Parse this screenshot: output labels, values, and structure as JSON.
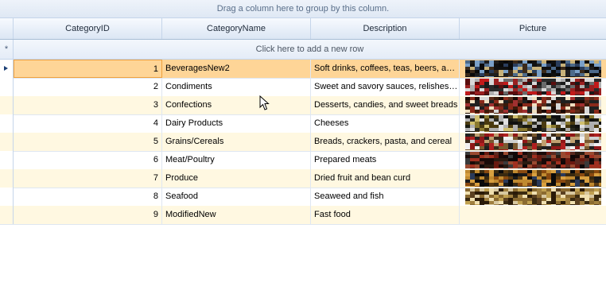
{
  "group_panel": {
    "text": "Drag a column here to group by this column."
  },
  "columns": [
    "CategoryID",
    "CategoryName",
    "Description",
    "Picture"
  ],
  "new_row": {
    "indicator": "*",
    "text": "Click here to add a new row"
  },
  "rows": [
    {
      "id": "1",
      "name": "BeveragesNew2",
      "description": "Soft drinks, coffees, teas, beers, and ales",
      "picture": "beverages-image",
      "selected": true
    },
    {
      "id": "2",
      "name": "Condiments",
      "description": "Sweet and savory sauces, relishes, spreads, and seasonings",
      "picture": "condiments-image"
    },
    {
      "id": "3",
      "name": "Confections",
      "description": "Desserts, candies, and sweet breads",
      "picture": "confections-image"
    },
    {
      "id": "4",
      "name": "Dairy Products",
      "description": "Cheeses",
      "picture": "dairy-image"
    },
    {
      "id": "5",
      "name": "Grains/Cereals",
      "description": "Breads, crackers, pasta, and cereal",
      "picture": "grains-image"
    },
    {
      "id": "6",
      "name": "Meat/Poultry",
      "description": "Prepared meats",
      "picture": "meat-image"
    },
    {
      "id": "7",
      "name": "Produce",
      "description": "Dried fruit and bean curd",
      "picture": "produce-image"
    },
    {
      "id": "8",
      "name": "Seafood",
      "description": "Seaweed and fish",
      "picture": "seafood-image"
    },
    {
      "id": "9",
      "name": "ModifiedNew",
      "description": "Fast food",
      "picture": ""
    }
  ],
  "colors": {
    "selected_row": "#fed597",
    "alt_row": "#fff8e1",
    "header": "#dbe6f4",
    "border": "#c5d5ea"
  }
}
